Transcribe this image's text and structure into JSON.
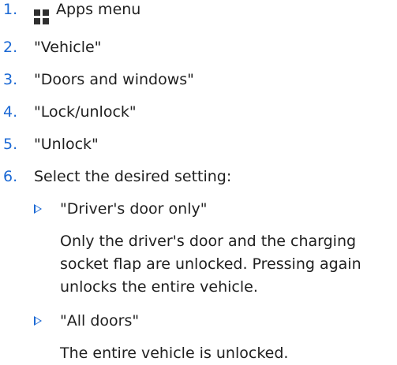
{
  "colors": {
    "accent": "#1c69d4",
    "text": "#1f1f1f",
    "icon": "#2f2f2f"
  },
  "steps": [
    {
      "num": "1.",
      "text": "Apps menu",
      "icon": "apps-grid-icon"
    },
    {
      "num": "2.",
      "text": "\"Vehicle\""
    },
    {
      "num": "3.",
      "text": "\"Doors and windows\""
    },
    {
      "num": "4.",
      "text": "\"Lock/unlock\""
    },
    {
      "num": "5.",
      "text": "\"Unlock\""
    },
    {
      "num": "6.",
      "text": "Select the desired setting:"
    }
  ],
  "options": [
    {
      "title": "\"Driver's door only\"",
      "description_lines": [
        "Only the driver's door and the charging",
        "socket flap are unlocked. Pressing again",
        "unlocks the entire vehicle."
      ]
    },
    {
      "title": "\"All doors\"",
      "description_lines": [
        "The entire vehicle is unlocked."
      ]
    }
  ]
}
